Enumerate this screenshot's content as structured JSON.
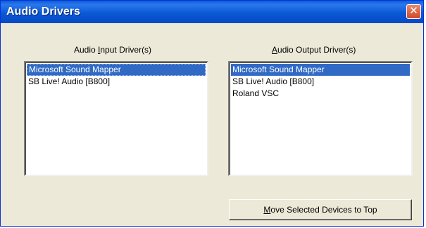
{
  "window": {
    "title": "Audio Drivers",
    "close_glyph": "✕"
  },
  "input": {
    "label_pre": "Audio ",
    "label_accel": "I",
    "label_post": "nput Driver(s)",
    "items": [
      {
        "label": "Microsoft Sound Mapper",
        "selected": true
      },
      {
        "label": "SB Live! Audio [B800]",
        "selected": false
      }
    ]
  },
  "output": {
    "label_pre": "",
    "label_accel": "A",
    "label_post": "udio Output Driver(s)",
    "items": [
      {
        "label": "Microsoft Sound Mapper",
        "selected": true
      },
      {
        "label": "SB Live! Audio [B800]",
        "selected": false
      },
      {
        "label": "Roland VSC",
        "selected": false
      }
    ]
  },
  "actions": {
    "move_pre": "",
    "move_accel": "M",
    "move_post": "ove Selected Devices to Top"
  },
  "colors": {
    "title_bar": "#0b59d6",
    "selection": "#316ac5",
    "dialog_bg": "#ece9d8",
    "close_button": "#d2482a"
  },
  "icons": {
    "close": "close-icon"
  }
}
